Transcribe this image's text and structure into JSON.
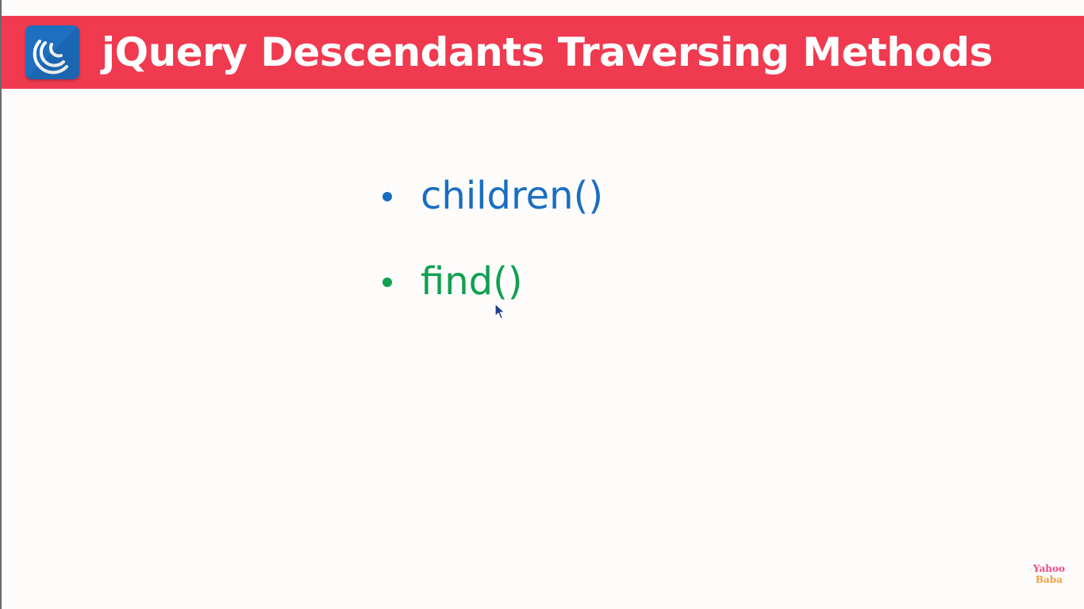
{
  "slide": {
    "title": "jQuery Descendants Traversing Methods",
    "logo_icon": "jquery-logo-icon",
    "colors": {
      "title_bar": "#f03a50",
      "logo_bg": "#1e6fc0",
      "item_blue": "#1a6ec1",
      "item_green": "#10a050"
    },
    "items": [
      {
        "label": "children()",
        "color": "#1a6ec1"
      },
      {
        "label": "find()",
        "color": "#10a050"
      }
    ],
    "watermark": {
      "line1": "Yahoo",
      "line2": "Baba"
    }
  }
}
